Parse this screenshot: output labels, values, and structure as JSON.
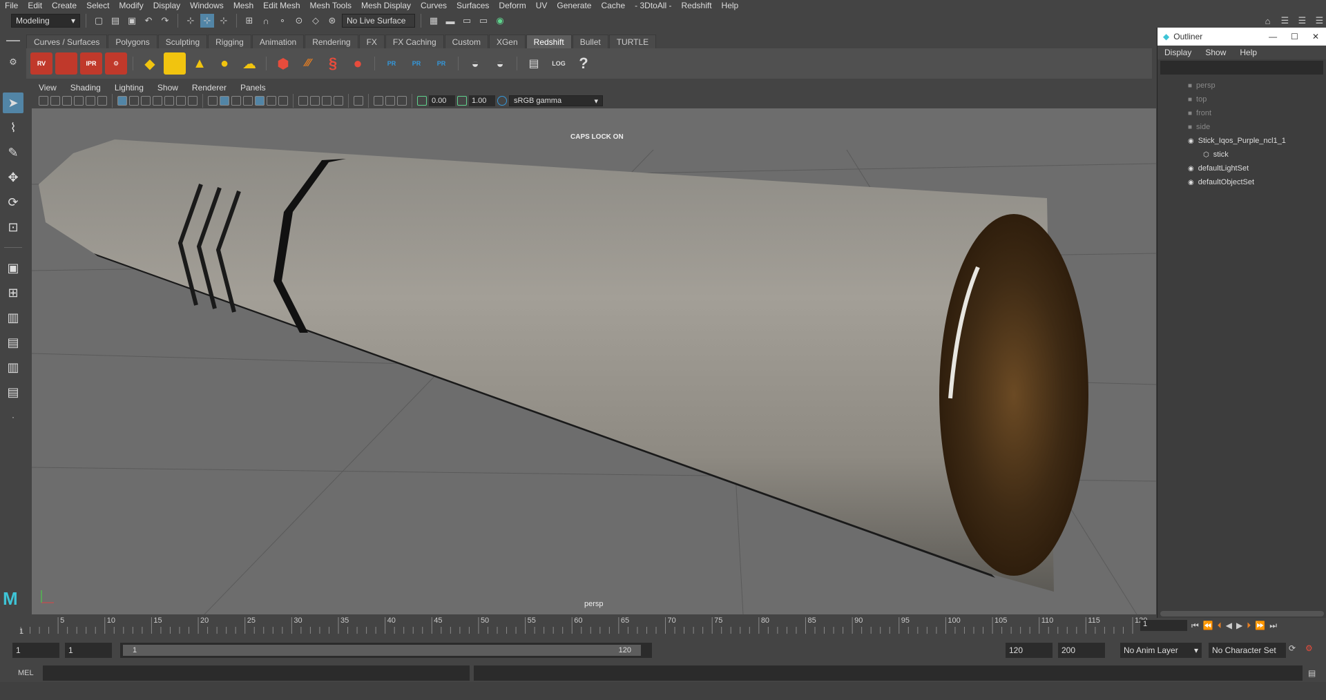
{
  "menubar": [
    "File",
    "Edit",
    "Create",
    "Select",
    "Modify",
    "Display",
    "Windows",
    "Mesh",
    "Edit Mesh",
    "Mesh Tools",
    "Mesh Display",
    "Curves",
    "Surfaces",
    "Deform",
    "UV",
    "Generate",
    "Cache",
    "- 3DtoAll -",
    "Redshift",
    "Help"
  ],
  "status": {
    "mode": "Modeling",
    "live_surface": "No Live Surface"
  },
  "shelf_tabs": [
    "Curves / Surfaces",
    "Polygons",
    "Sculpting",
    "Rigging",
    "Animation",
    "Rendering",
    "FX",
    "FX Caching",
    "Custom",
    "XGen",
    "Redshift",
    "Bullet",
    "TURTLE"
  ],
  "shelf_active": "Redshift",
  "shelf_icons": [
    "RV",
    "",
    "IPR",
    "",
    "",
    "",
    "",
    "",
    "",
    "",
    "",
    "",
    "PR",
    "PR",
    "PR",
    "",
    "",
    "",
    "LOG",
    "?"
  ],
  "viewport_menu": [
    "View",
    "Shading",
    "Lighting",
    "Show",
    "Renderer",
    "Panels"
  ],
  "viewport_toolbar": {
    "exposure": "0.00",
    "gamma": "1.00",
    "colorspace": "sRGB gamma"
  },
  "viewport": {
    "caps_lock": "CAPS LOCK ON",
    "camera": "persp"
  },
  "outliner": {
    "title": "Outliner",
    "menu": [
      "Display",
      "Show",
      "Help"
    ],
    "items": [
      {
        "label": "persp",
        "dim": true,
        "indent": 1
      },
      {
        "label": "top",
        "dim": true,
        "indent": 1
      },
      {
        "label": "front",
        "dim": true,
        "indent": 1
      },
      {
        "label": "side",
        "dim": true,
        "indent": 1
      },
      {
        "label": "Stick_Iqos_Purple_ncl1_1",
        "dim": false,
        "indent": 1
      },
      {
        "label": "stick",
        "dim": false,
        "indent": 2
      },
      {
        "label": "defaultLightSet",
        "dim": false,
        "indent": 1
      },
      {
        "label": "defaultObjectSet",
        "dim": false,
        "indent": 1
      }
    ]
  },
  "timeline": {
    "ticks": [
      "5",
      "10",
      "15",
      "20",
      "25",
      "30",
      "35",
      "40",
      "45",
      "50",
      "55",
      "60",
      "65",
      "70",
      "75",
      "80",
      "85",
      "90",
      "95",
      "100",
      "105",
      "110",
      "115",
      "120"
    ],
    "current_frame": "1",
    "first": "1"
  },
  "range": {
    "start": "1",
    "start2": "1",
    "slider_start": "1",
    "slider_end": "120",
    "end": "120",
    "total": "200",
    "anim_layer": "No Anim Layer",
    "char_set": "No Character Set"
  },
  "cmd": {
    "label": "MEL"
  }
}
